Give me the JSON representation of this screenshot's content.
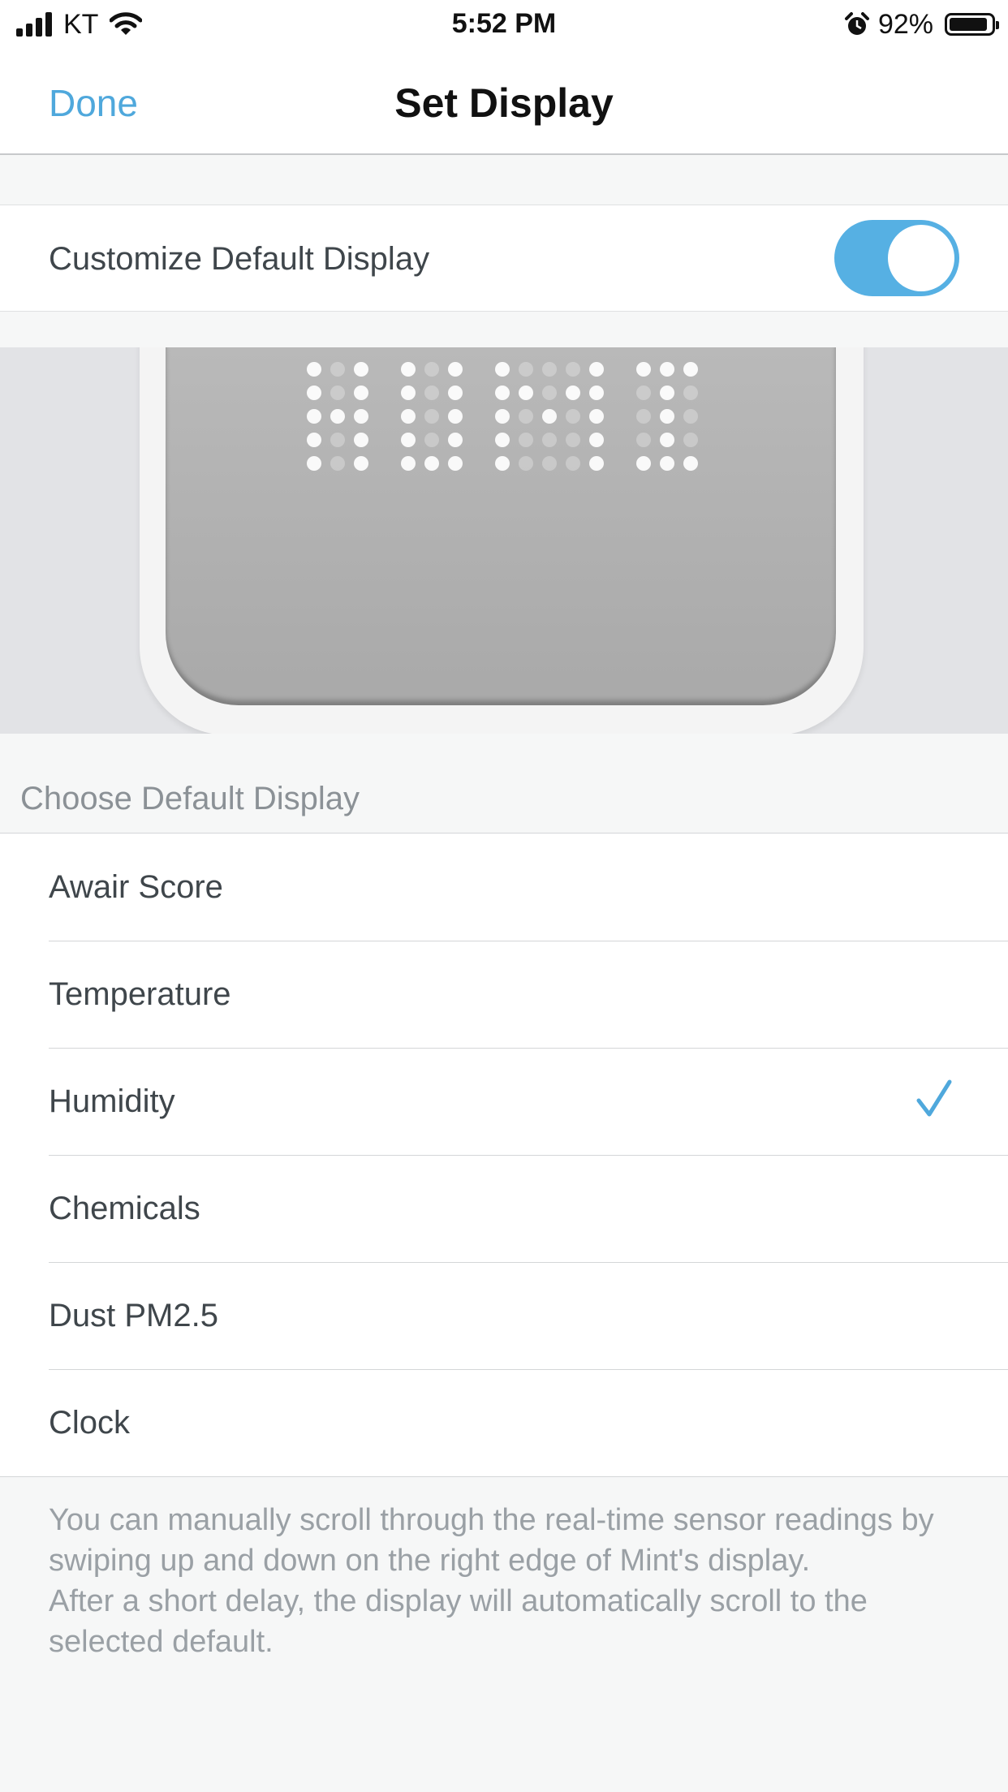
{
  "status_bar": {
    "carrier": "KT",
    "time": "5:52 PM",
    "battery": "92%",
    "battery_level": 0.92,
    "icons": [
      "signal-icon",
      "wifi-icon",
      "alarm-icon",
      "battery-icon"
    ]
  },
  "nav": {
    "done": "Done",
    "title": "Set Display"
  },
  "customize": {
    "label": "Customize Default Display",
    "enabled": true
  },
  "preview": {
    "display_text": "HUMI"
  },
  "section": {
    "header": "Choose Default Display"
  },
  "options": [
    {
      "label": "Awair Score",
      "selected": false
    },
    {
      "label": "Temperature",
      "selected": false
    },
    {
      "label": "Humidity",
      "selected": true
    },
    {
      "label": "Chemicals",
      "selected": false
    },
    {
      "label": "Dust PM2.5",
      "selected": false
    },
    {
      "label": "Clock",
      "selected": false
    }
  ],
  "footer": {
    "line1": "You can manually scroll through the real-time sensor readings by swiping up and down on the right edge of Mint's display.",
    "line2": "After a short delay, the display will automatically scroll to the selected default."
  },
  "colors": {
    "accent": "#4fa8dc",
    "toggle_on": "#56b0e3",
    "background": "#f6f7f7"
  }
}
